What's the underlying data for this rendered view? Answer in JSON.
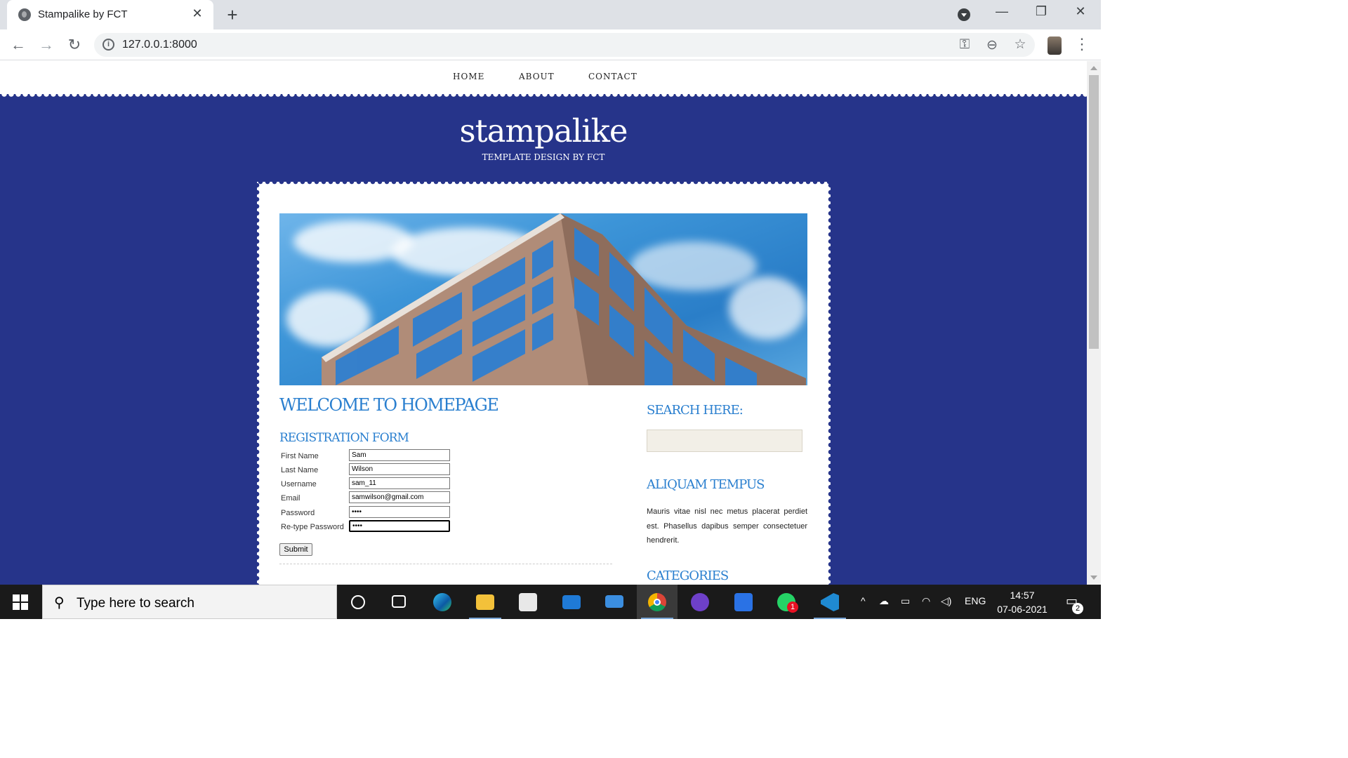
{
  "browser": {
    "tab_title": "Stampalike by FCT",
    "tab_close": "✕",
    "new_tab": "+",
    "url": "127.0.0.1:8000",
    "window_controls": {
      "minimize": "—",
      "restore": "❐",
      "close": "✕"
    },
    "icons": [
      "back-icon",
      "forward-icon",
      "reload-icon",
      "info-icon",
      "key-icon",
      "zoom-icon",
      "star-icon",
      "menu-icon"
    ]
  },
  "site": {
    "nav": [
      "HOME",
      "ABOUT",
      "CONTACT"
    ],
    "logo": "stampalike",
    "tagline": "TEMPLATE DESIGN BY FCT",
    "welcome": "WELCOME TO HOMEPAGE",
    "form_title": "REGISTRATION FORM",
    "form": [
      {
        "label": "First Name",
        "value": "Sam",
        "type": "text"
      },
      {
        "label": "Last Name",
        "value": "Wilson",
        "type": "text"
      },
      {
        "label": "Username",
        "value": "sam_11",
        "type": "text"
      },
      {
        "label": "Email",
        "value": "samwilson@gmail.com",
        "type": "text"
      },
      {
        "label": "Password",
        "value": "••••",
        "type": "password"
      },
      {
        "label": "Re-type Password",
        "value": "••••",
        "type": "password"
      }
    ],
    "submit": "Submit",
    "sidebar": {
      "search_title": "SEARCH HERE:",
      "aliquam_title": "ALIQUAM TEMPUS",
      "aliquam_text": "Mauris vitae nisl nec metus placerat perdiet est. Phasellus dapibus semper consectetuer hendrerit.",
      "categories_title": "CATEGORIES"
    },
    "colors": {
      "background": "#26348a",
      "heading": "#2a7fcf"
    }
  },
  "taskbar": {
    "search_placeholder": "Type here to search",
    "lang": "ENG",
    "time": "14:57",
    "date": "07-06-2021",
    "whatsapp_badge": "1",
    "notification_count": "2"
  }
}
